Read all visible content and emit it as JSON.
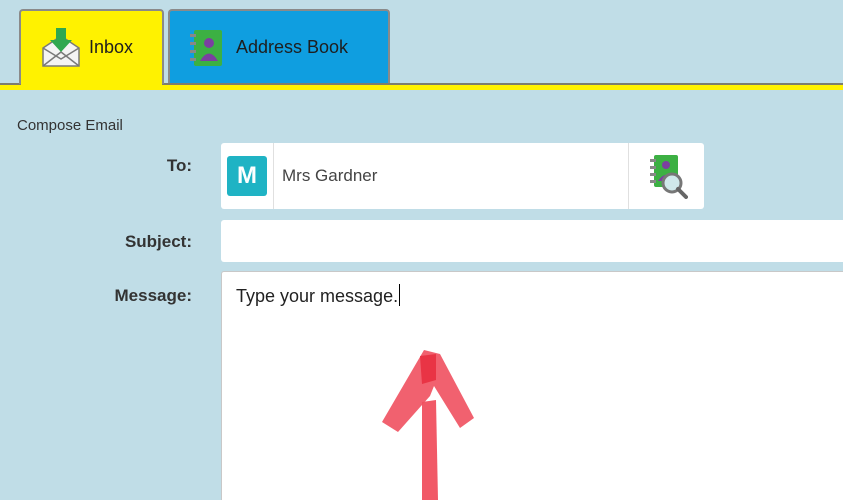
{
  "tabs": [
    {
      "label": "Inbox",
      "icon": "inbox-tray-icon",
      "color": "#fff200",
      "active": true
    },
    {
      "label": "Address Book",
      "icon": "address-book-icon",
      "color": "#0f9ee0",
      "active": false
    }
  ],
  "compose": {
    "title": "Compose Email",
    "to_label": "To:",
    "subject_label": "Subject:",
    "message_label": "Message:",
    "recipient": {
      "initial": "M",
      "name": "Mrs Gardner",
      "avatar_color": "#1fb3c4"
    },
    "subject_value": "",
    "message_text": "Type your message.",
    "address_lookup_icon": "address-book-search-icon"
  },
  "annotation": {
    "icon": "red-arrow-annotation-icon",
    "color": "#f0505f"
  }
}
